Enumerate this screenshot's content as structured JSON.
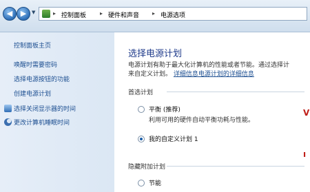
{
  "breadcrumb": {
    "items": [
      "控制面板",
      "硬件和声音",
      "电源选项"
    ],
    "separator": "▸"
  },
  "left_pane": {
    "home": "控制面板主页",
    "links": [
      "唤醒时需要密码",
      "选择电源按钮的功能",
      "创建电源计划",
      "选择关闭显示器的时间",
      "更改计算机睡眠时间"
    ]
  },
  "main": {
    "title": "选择电源计划",
    "description_line1": "电源计划有助于最大化计算机的性能或者节能。通过选择计",
    "description_line2_prefix": "来自定义计划。",
    "description_link": "详细信息电源计划的详细信息",
    "preferred_group": "首选计划",
    "plans": [
      {
        "name": "平衡 (推荐)",
        "desc": "利用可用的硬件自动平衡功耗与性能。",
        "selected": false
      },
      {
        "name": "我的自定义计划 1",
        "selected": true
      }
    ],
    "hidden_group": "隐藏附加计划",
    "hidden_plans": [
      {
        "name": "节能",
        "selected": false
      }
    ]
  },
  "colors": {
    "accent": "#1e3a8a",
    "link": "#1d4f91"
  },
  "icons": [
    "back-arrow-icon",
    "forward-arrow-icon",
    "control-panel-icon",
    "monitor-icon",
    "moon-icon"
  ]
}
